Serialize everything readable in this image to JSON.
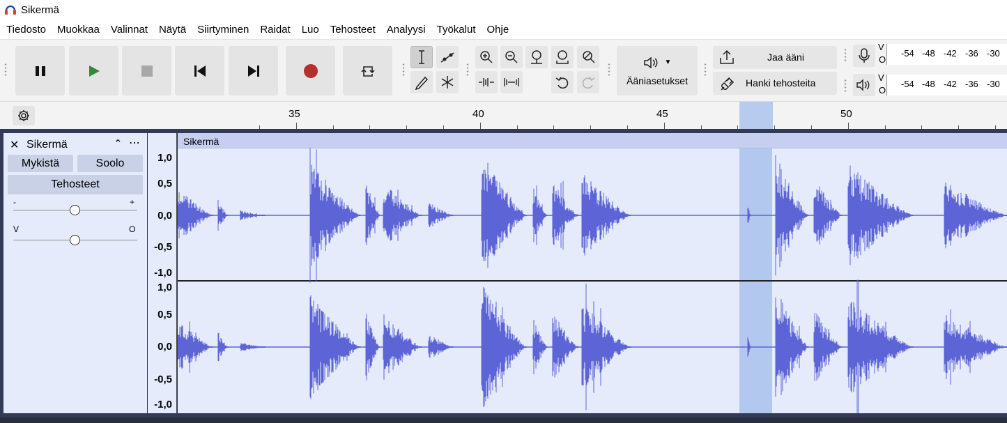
{
  "window": {
    "title": "Sikermä"
  },
  "menu": [
    "Tiedosto",
    "Muokkaa",
    "Valinnat",
    "Näytä",
    "Siirtyminen",
    "Raidat",
    "Luo",
    "Tehosteet",
    "Analyysi",
    "Työkalut",
    "Ohje"
  ],
  "toolbar": {
    "audio_setup_label": "Ääniasetukset",
    "share_audio_label": "Jaa ääni",
    "get_effects_label": "Hanki tehosteita",
    "record_meter": {
      "lr_top": "V",
      "lr_bottom": "O",
      "scale": [
        "-54",
        "-48",
        "-42",
        "-36",
        "-30"
      ]
    },
    "play_meter": {
      "lr_top": "V",
      "lr_bottom": "O",
      "scale": [
        "-54",
        "-48",
        "-42",
        "-36",
        "-30"
      ]
    }
  },
  "timeline": {
    "labels": [
      "35",
      "40",
      "45",
      "50"
    ]
  },
  "track": {
    "name": "Sikermä",
    "clip_name": "Sikermä",
    "mute_label": "Mykistä",
    "solo_label": "Soolo",
    "effects_label": "Tehosteet",
    "gain_minus": "-",
    "gain_plus": "+",
    "pan_left": "V",
    "pan_right": "O",
    "scale_labels": [
      "1,0",
      "0,5",
      "0,0",
      "-0,5",
      "-1,0"
    ]
  },
  "colors": {
    "waveform": "#5d64d6",
    "selection": "#b7cbef",
    "track_bg": "#e5ebfb",
    "record": "#b4302b",
    "play": "#2f8a3b"
  }
}
